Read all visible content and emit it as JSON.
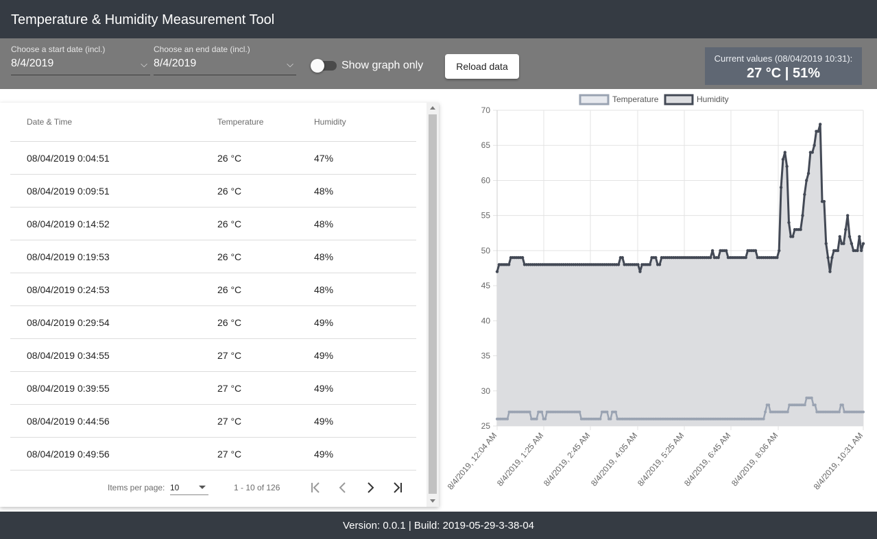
{
  "app": {
    "title": "Temperature & Humidity Measurement Tool"
  },
  "filters": {
    "start_label": "Choose a start date (incl.)",
    "start_value": "8/4/2019",
    "end_label": "Choose an end date (incl.)",
    "end_value": "8/4/2019",
    "toggle_label": "Show graph only",
    "toggle_on": false,
    "reload_label": "Reload data"
  },
  "current": {
    "label": "Current values (08/04/2019 10:31):",
    "value": "27 °C | 51%"
  },
  "table": {
    "headers": [
      "Date & Time",
      "Temperature",
      "Humidity"
    ],
    "rows": [
      [
        "08/04/2019 0:04:51",
        "26 °C",
        "47%"
      ],
      [
        "08/04/2019 0:09:51",
        "26 °C",
        "48%"
      ],
      [
        "08/04/2019 0:14:52",
        "26 °C",
        "48%"
      ],
      [
        "08/04/2019 0:19:53",
        "26 °C",
        "48%"
      ],
      [
        "08/04/2019 0:24:53",
        "26 °C",
        "48%"
      ],
      [
        "08/04/2019 0:29:54",
        "26 °C",
        "49%"
      ],
      [
        "08/04/2019 0:34:55",
        "27 °C",
        "49%"
      ],
      [
        "08/04/2019 0:39:55",
        "27 °C",
        "49%"
      ],
      [
        "08/04/2019 0:44:56",
        "27 °C",
        "49%"
      ],
      [
        "08/04/2019 0:49:56",
        "27 °C",
        "49%"
      ]
    ],
    "paginator": {
      "items_per_page_label": "Items per page:",
      "items_per_page": "10",
      "range": "1 - 10 of 126"
    }
  },
  "footer": {
    "text": "Version: 0.0.1 | Build: 2019-05-29-3-38-04"
  },
  "chart_data": {
    "type": "line",
    "legend": [
      "Temperature",
      "Humidity"
    ],
    "legend_position": "top",
    "ylim": [
      25,
      70
    ],
    "yticks": [
      25,
      30,
      35,
      40,
      45,
      50,
      55,
      60,
      65,
      70
    ],
    "x_tick_labels": [
      "8/4/2019, 12:04 AM",
      "8/4/2019, 1:25 AM",
      "8/4/2019, 2:45 AM",
      "8/4/2019, 4:05 AM",
      "8/4/2019, 5:25 AM",
      "8/4/2019, 6:45 AM",
      "8/4/2019, 8:06 AM",
      "8/4/2019, 10:31 AM"
    ],
    "grid": true,
    "colors": {
      "temperature": "#9aa3b2",
      "humidity": "#434955",
      "fill": "#dcdde0",
      "grid": "#e3e3e3"
    },
    "series": [
      {
        "name": "Temperature",
        "values": [
          26,
          26,
          26,
          26,
          26,
          26,
          26,
          27,
          27,
          27,
          27,
          27,
          27,
          27,
          27,
          27,
          27,
          27,
          27,
          27,
          26,
          26,
          26,
          26,
          27,
          27,
          27,
          26,
          26,
          27,
          27,
          27,
          27,
          27,
          27,
          27,
          27,
          27,
          27,
          27,
          27,
          27,
          27,
          27,
          27,
          27,
          27,
          27,
          27,
          26,
          26,
          26,
          26,
          26,
          26,
          26,
          26,
          26,
          26,
          26,
          26,
          27,
          27,
          27,
          27,
          26,
          26,
          27,
          27,
          27,
          26,
          26,
          26,
          26,
          26,
          26,
          26,
          26,
          26,
          26,
          26,
          26,
          26,
          26,
          26,
          26,
          26,
          26,
          26,
          26,
          26,
          26,
          26,
          26,
          26,
          26,
          26,
          26,
          26,
          26,
          26,
          26,
          26,
          26,
          26,
          26,
          26,
          26,
          26,
          26,
          26,
          26,
          26,
          26,
          26,
          26,
          26,
          26,
          26,
          26,
          26,
          26,
          26,
          26,
          26,
          26,
          26,
          26,
          26,
          26,
          26,
          26,
          26,
          26,
          26,
          26,
          26,
          26,
          26,
          26,
          26,
          26,
          26,
          26,
          26,
          26,
          26,
          26,
          26,
          26,
          26,
          26,
          26,
          26,
          26,
          26,
          27,
          28,
          28,
          27,
          27,
          27,
          27,
          27,
          27,
          27,
          27,
          27,
          27,
          27,
          28,
          28,
          28,
          28,
          28,
          28,
          28,
          28,
          28,
          28,
          29,
          29,
          29,
          29,
          28,
          28,
          27,
          27,
          27,
          27,
          27,
          27,
          27,
          27,
          27,
          27,
          27,
          27,
          27,
          27,
          28,
          28,
          27,
          27,
          27,
          27,
          27,
          27,
          27,
          27,
          27,
          27,
          27,
          27
        ]
      },
      {
        "name": "Humidity",
        "values": [
          47,
          48,
          48,
          48,
          48,
          48,
          48,
          49,
          49,
          49,
          49,
          49,
          49,
          49,
          48,
          48,
          48,
          48,
          48,
          48,
          48,
          48,
          48,
          48,
          48,
          48,
          48,
          48,
          48,
          48,
          48,
          48,
          48,
          48,
          48,
          48,
          48,
          48,
          48,
          48,
          48,
          48,
          48,
          48,
          48,
          48,
          48,
          48,
          48,
          48,
          48,
          48,
          48,
          48,
          48,
          48,
          48,
          48,
          48,
          48,
          48,
          48,
          48,
          49,
          49,
          48,
          48,
          48,
          48,
          48,
          48,
          48,
          48,
          47,
          48,
          48,
          48,
          48,
          48,
          49,
          49,
          49,
          48,
          48,
          49,
          49,
          49,
          49,
          49,
          49,
          49,
          49,
          49,
          49,
          49,
          49,
          49,
          49,
          49,
          49,
          49,
          49,
          49,
          49,
          49,
          49,
          49,
          49,
          49,
          49,
          50,
          49,
          49,
          49,
          50,
          50,
          50,
          50,
          49,
          49,
          49,
          49,
          49,
          49,
          49,
          49,
          49,
          49,
          50,
          50,
          50,
          50,
          50,
          49,
          49,
          49,
          49,
          49,
          49,
          49,
          49,
          49,
          49,
          49,
          50,
          59,
          63,
          64,
          62,
          54,
          52,
          52,
          53,
          53,
          53,
          53,
          55,
          58,
          60,
          61,
          64,
          64,
          65,
          67,
          67,
          68,
          57,
          57,
          51,
          49,
          47,
          49,
          50,
          50,
          50,
          52,
          51,
          51,
          53,
          55,
          52,
          51,
          50,
          50,
          50,
          52,
          50,
          51
        ]
      }
    ]
  }
}
